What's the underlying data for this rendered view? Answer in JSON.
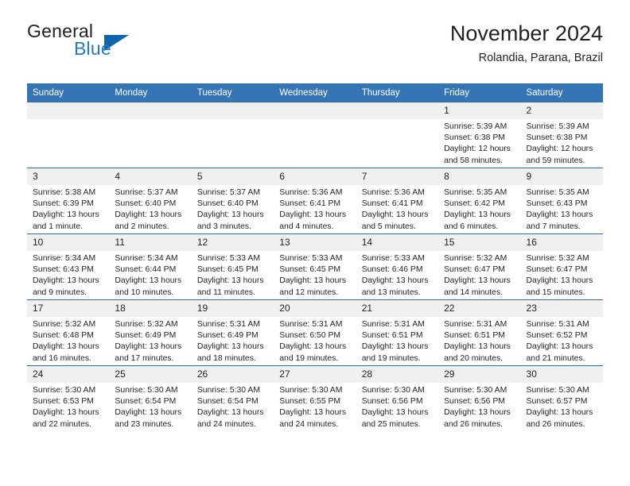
{
  "brand": {
    "name_part1": "General",
    "name_part2": "Blue",
    "accent_color": "#1f7cc4",
    "triangle_color": "#1064ab"
  },
  "header": {
    "title": "November 2024",
    "subtitle": "Rolandia, Parana, Brazil",
    "header_bg": "#3575b5",
    "daynum_bg": "#f0f0f0",
    "row_border_color": "#2d6ca8"
  },
  "weekday_headers": [
    "Sunday",
    "Monday",
    "Tuesday",
    "Wednesday",
    "Thursday",
    "Friday",
    "Saturday"
  ],
  "weeks": [
    [
      {
        "day": "",
        "sunrise": "",
        "sunset": "",
        "daylight": ""
      },
      {
        "day": "",
        "sunrise": "",
        "sunset": "",
        "daylight": ""
      },
      {
        "day": "",
        "sunrise": "",
        "sunset": "",
        "daylight": ""
      },
      {
        "day": "",
        "sunrise": "",
        "sunset": "",
        "daylight": ""
      },
      {
        "day": "",
        "sunrise": "",
        "sunset": "",
        "daylight": ""
      },
      {
        "day": "1",
        "sunrise": "Sunrise: 5:39 AM",
        "sunset": "Sunset: 6:38 PM",
        "daylight": "Daylight: 12 hours and 58 minutes."
      },
      {
        "day": "2",
        "sunrise": "Sunrise: 5:39 AM",
        "sunset": "Sunset: 6:38 PM",
        "daylight": "Daylight: 12 hours and 59 minutes."
      }
    ],
    [
      {
        "day": "3",
        "sunrise": "Sunrise: 5:38 AM",
        "sunset": "Sunset: 6:39 PM",
        "daylight": "Daylight: 13 hours and 1 minute."
      },
      {
        "day": "4",
        "sunrise": "Sunrise: 5:37 AM",
        "sunset": "Sunset: 6:40 PM",
        "daylight": "Daylight: 13 hours and 2 minutes."
      },
      {
        "day": "5",
        "sunrise": "Sunrise: 5:37 AM",
        "sunset": "Sunset: 6:40 PM",
        "daylight": "Daylight: 13 hours and 3 minutes."
      },
      {
        "day": "6",
        "sunrise": "Sunrise: 5:36 AM",
        "sunset": "Sunset: 6:41 PM",
        "daylight": "Daylight: 13 hours and 4 minutes."
      },
      {
        "day": "7",
        "sunrise": "Sunrise: 5:36 AM",
        "sunset": "Sunset: 6:41 PM",
        "daylight": "Daylight: 13 hours and 5 minutes."
      },
      {
        "day": "8",
        "sunrise": "Sunrise: 5:35 AM",
        "sunset": "Sunset: 6:42 PM",
        "daylight": "Daylight: 13 hours and 6 minutes."
      },
      {
        "day": "9",
        "sunrise": "Sunrise: 5:35 AM",
        "sunset": "Sunset: 6:43 PM",
        "daylight": "Daylight: 13 hours and 7 minutes."
      }
    ],
    [
      {
        "day": "10",
        "sunrise": "Sunrise: 5:34 AM",
        "sunset": "Sunset: 6:43 PM",
        "daylight": "Daylight: 13 hours and 9 minutes."
      },
      {
        "day": "11",
        "sunrise": "Sunrise: 5:34 AM",
        "sunset": "Sunset: 6:44 PM",
        "daylight": "Daylight: 13 hours and 10 minutes."
      },
      {
        "day": "12",
        "sunrise": "Sunrise: 5:33 AM",
        "sunset": "Sunset: 6:45 PM",
        "daylight": "Daylight: 13 hours and 11 minutes."
      },
      {
        "day": "13",
        "sunrise": "Sunrise: 5:33 AM",
        "sunset": "Sunset: 6:45 PM",
        "daylight": "Daylight: 13 hours and 12 minutes."
      },
      {
        "day": "14",
        "sunrise": "Sunrise: 5:33 AM",
        "sunset": "Sunset: 6:46 PM",
        "daylight": "Daylight: 13 hours and 13 minutes."
      },
      {
        "day": "15",
        "sunrise": "Sunrise: 5:32 AM",
        "sunset": "Sunset: 6:47 PM",
        "daylight": "Daylight: 13 hours and 14 minutes."
      },
      {
        "day": "16",
        "sunrise": "Sunrise: 5:32 AM",
        "sunset": "Sunset: 6:47 PM",
        "daylight": "Daylight: 13 hours and 15 minutes."
      }
    ],
    [
      {
        "day": "17",
        "sunrise": "Sunrise: 5:32 AM",
        "sunset": "Sunset: 6:48 PM",
        "daylight": "Daylight: 13 hours and 16 minutes."
      },
      {
        "day": "18",
        "sunrise": "Sunrise: 5:32 AM",
        "sunset": "Sunset: 6:49 PM",
        "daylight": "Daylight: 13 hours and 17 minutes."
      },
      {
        "day": "19",
        "sunrise": "Sunrise: 5:31 AM",
        "sunset": "Sunset: 6:49 PM",
        "daylight": "Daylight: 13 hours and 18 minutes."
      },
      {
        "day": "20",
        "sunrise": "Sunrise: 5:31 AM",
        "sunset": "Sunset: 6:50 PM",
        "daylight": "Daylight: 13 hours and 19 minutes."
      },
      {
        "day": "21",
        "sunrise": "Sunrise: 5:31 AM",
        "sunset": "Sunset: 6:51 PM",
        "daylight": "Daylight: 13 hours and 19 minutes."
      },
      {
        "day": "22",
        "sunrise": "Sunrise: 5:31 AM",
        "sunset": "Sunset: 6:51 PM",
        "daylight": "Daylight: 13 hours and 20 minutes."
      },
      {
        "day": "23",
        "sunrise": "Sunrise: 5:31 AM",
        "sunset": "Sunset: 6:52 PM",
        "daylight": "Daylight: 13 hours and 21 minutes."
      }
    ],
    [
      {
        "day": "24",
        "sunrise": "Sunrise: 5:30 AM",
        "sunset": "Sunset: 6:53 PM",
        "daylight": "Daylight: 13 hours and 22 minutes."
      },
      {
        "day": "25",
        "sunrise": "Sunrise: 5:30 AM",
        "sunset": "Sunset: 6:54 PM",
        "daylight": "Daylight: 13 hours and 23 minutes."
      },
      {
        "day": "26",
        "sunrise": "Sunrise: 5:30 AM",
        "sunset": "Sunset: 6:54 PM",
        "daylight": "Daylight: 13 hours and 24 minutes."
      },
      {
        "day": "27",
        "sunrise": "Sunrise: 5:30 AM",
        "sunset": "Sunset: 6:55 PM",
        "daylight": "Daylight: 13 hours and 24 minutes."
      },
      {
        "day": "28",
        "sunrise": "Sunrise: 5:30 AM",
        "sunset": "Sunset: 6:56 PM",
        "daylight": "Daylight: 13 hours and 25 minutes."
      },
      {
        "day": "29",
        "sunrise": "Sunrise: 5:30 AM",
        "sunset": "Sunset: 6:56 PM",
        "daylight": "Daylight: 13 hours and 26 minutes."
      },
      {
        "day": "30",
        "sunrise": "Sunrise: 5:30 AM",
        "sunset": "Sunset: 6:57 PM",
        "daylight": "Daylight: 13 hours and 26 minutes."
      }
    ]
  ]
}
